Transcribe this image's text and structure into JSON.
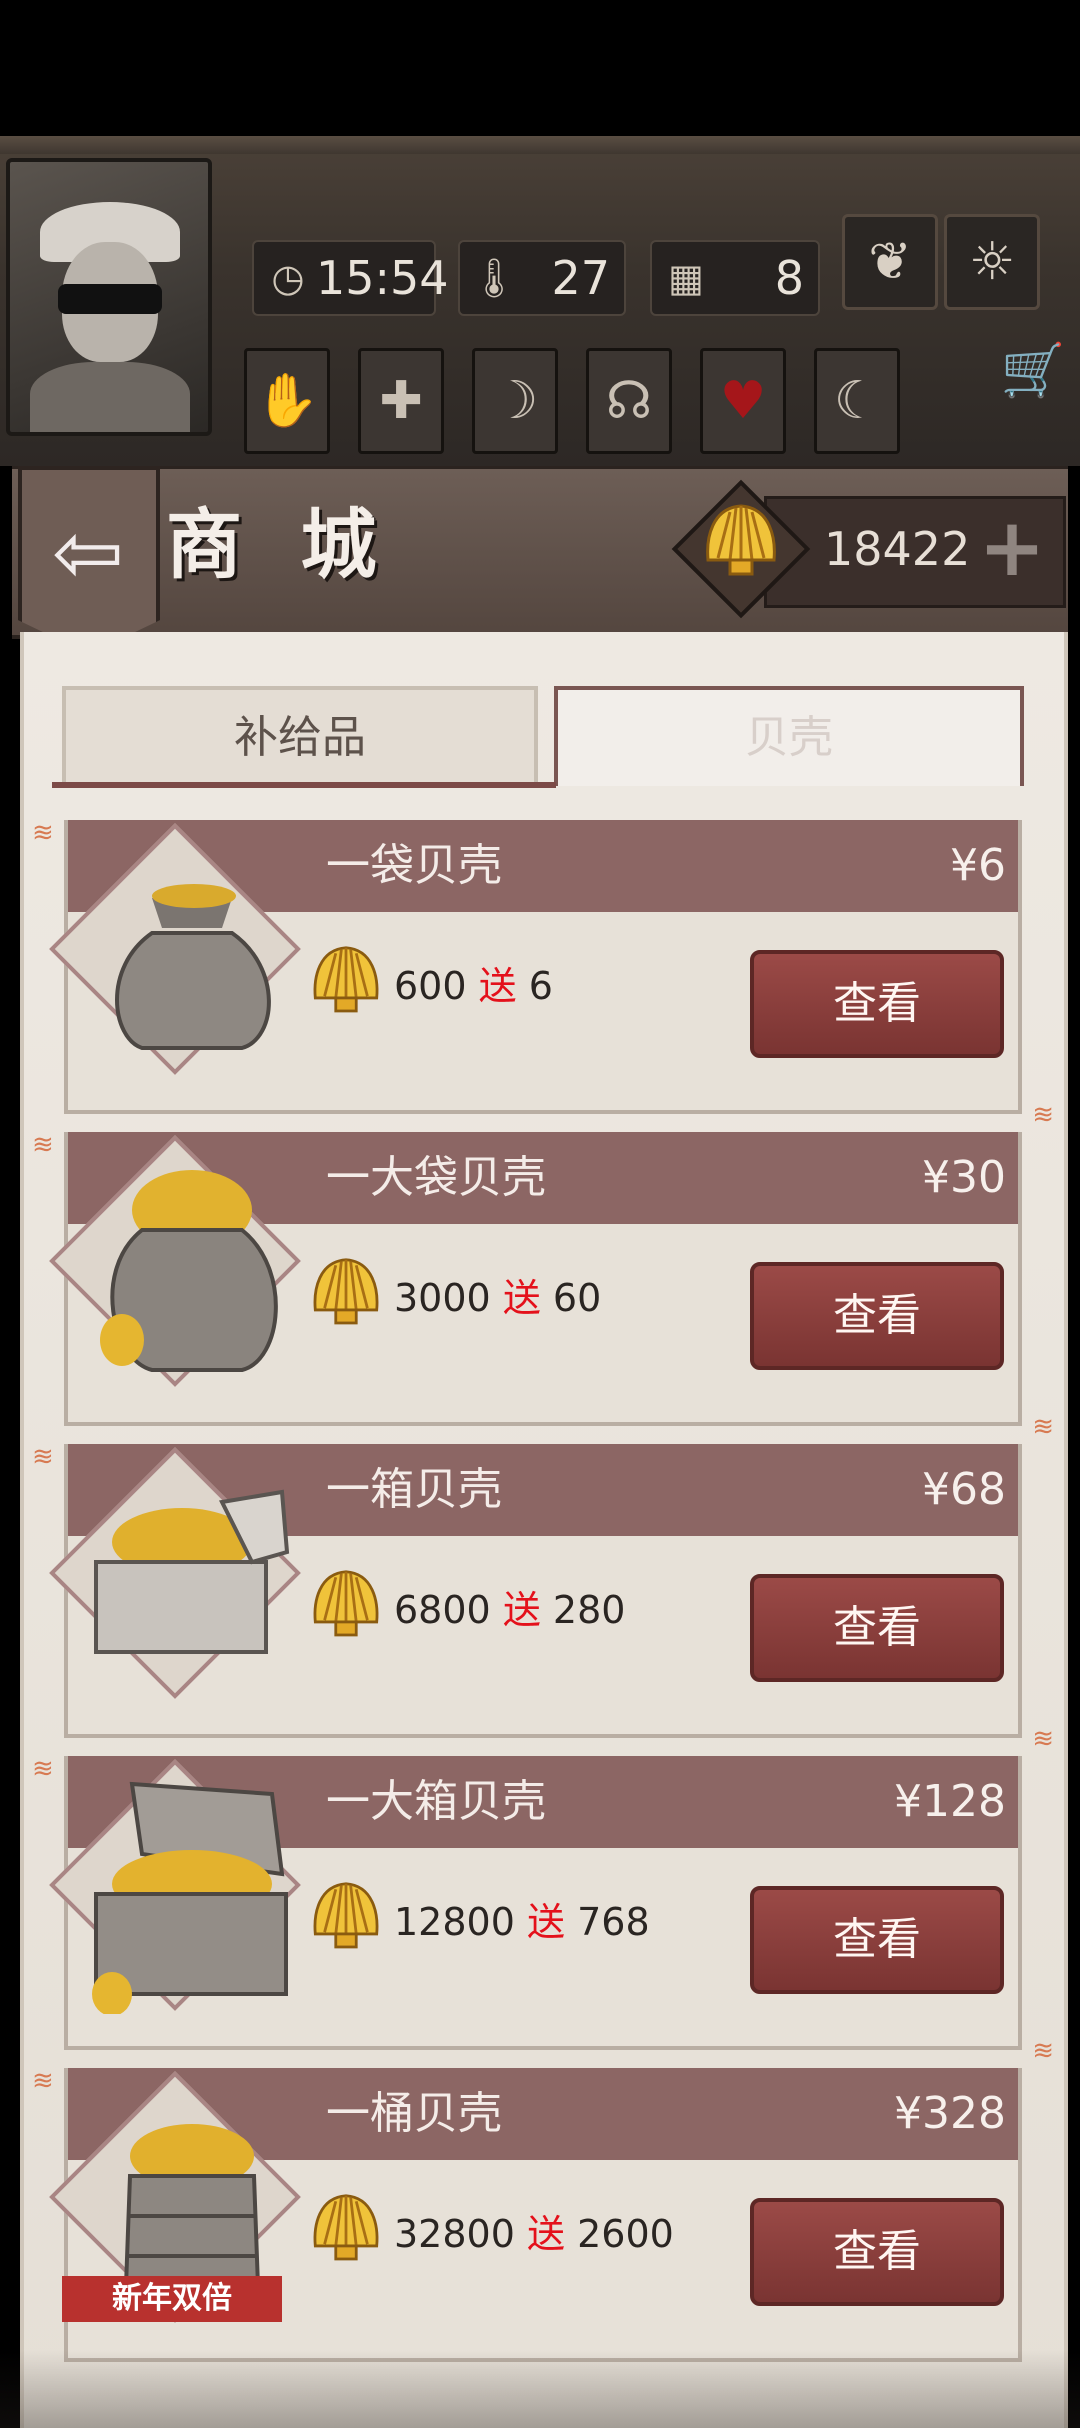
{
  "status": {
    "time": "15:54",
    "temperature": "27",
    "day": "8",
    "icons": [
      "clock-icon",
      "thermometer-icon",
      "calendar-icon",
      "leaf-icon",
      "sun-icon"
    ]
  },
  "toolbar": {
    "buttons": [
      "hand-icon",
      "medical-cross-icon",
      "stomach-icon",
      "brain-icon",
      "heart-icon",
      "moon-icon"
    ],
    "cart": "shopping-cart-icon"
  },
  "header": {
    "back": "back-arrow-icon",
    "title": "商 城",
    "shell_balance": "18422"
  },
  "tabs": [
    {
      "label": "补给品",
      "active": false
    },
    {
      "label": "贝壳",
      "active": true
    }
  ],
  "products": [
    {
      "name": "一袋贝壳",
      "price": "¥6",
      "amount": "600",
      "gift_word": "送",
      "bonus": "6",
      "button": "查看"
    },
    {
      "name": "一大袋贝壳",
      "price": "¥30",
      "amount": "3000",
      "gift_word": "送",
      "bonus": "60",
      "button": "查看"
    },
    {
      "name": "一箱贝壳",
      "price": "¥68",
      "amount": "6800",
      "gift_word": "送",
      "bonus": "280",
      "button": "查看"
    },
    {
      "name": "一大箱贝壳",
      "price": "¥128",
      "amount": "12800",
      "gift_word": "送",
      "bonus": "768",
      "button": "查看"
    },
    {
      "name": "一桶贝壳",
      "price": "¥328",
      "amount": "32800",
      "gift_word": "送",
      "bonus": "2600",
      "button": "查看"
    }
  ],
  "badge": "新年双倍",
  "colors": {
    "accent_red": "#8c6664",
    "button_red": "#8c3f3d",
    "gift_red": "#e4111b",
    "gold": "#e8b62a"
  }
}
